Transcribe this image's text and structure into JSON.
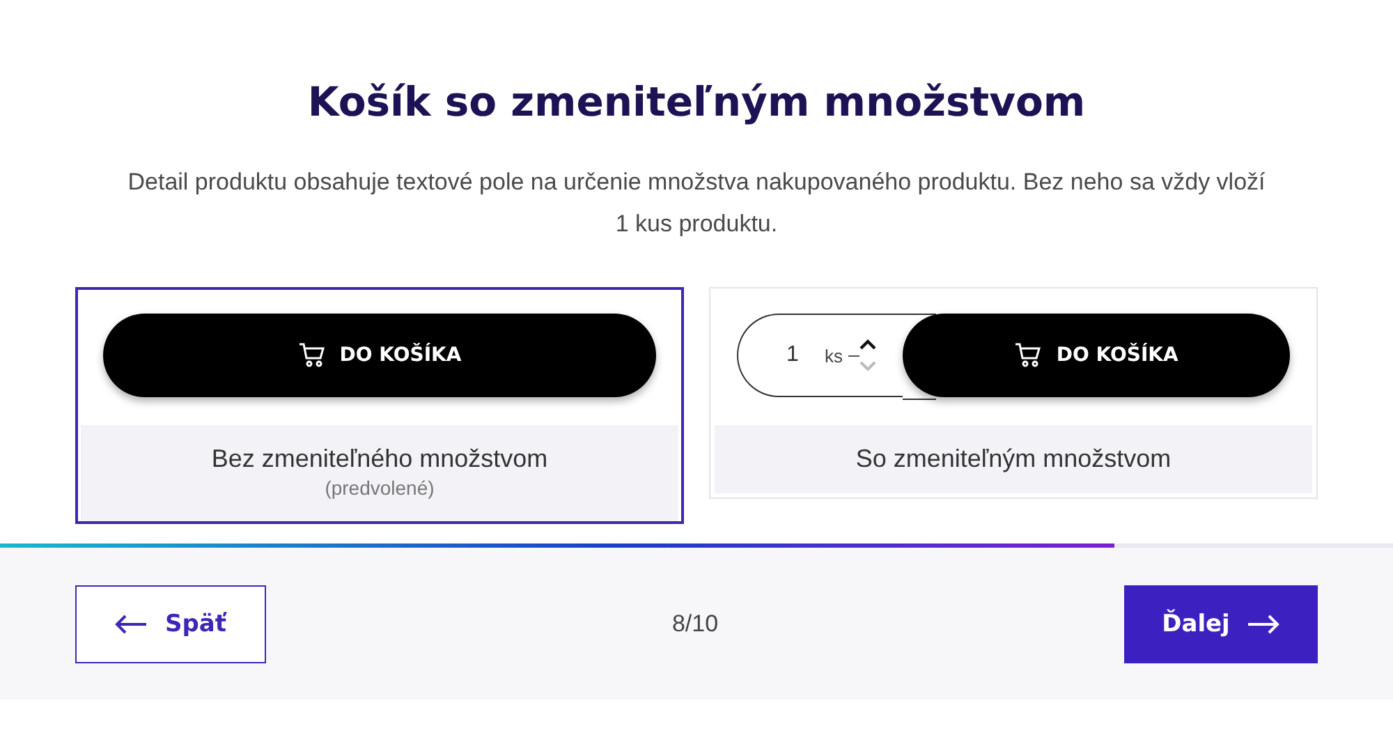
{
  "title": "Košík so zmeniteľným množstvom",
  "description": "Detail produktu obsahuje textové pole na určenie množstva nakupovaného produktu. Bez neho sa vždy vloží 1 kus produktu.",
  "options": [
    {
      "kind": "plain",
      "selected": true,
      "button": "DO KOŠÍKA",
      "label": "Bez zmeniteľného množstvom",
      "note": "(predvolené)"
    },
    {
      "kind": "quantity",
      "selected": false,
      "quantity": "1",
      "unit": "ks",
      "button": "DO KOŠÍKA",
      "label": "So zmeniteľným množstvom"
    }
  ],
  "progress": {
    "level": 0.8
  },
  "footer": {
    "back": "Späť",
    "step": "8/10",
    "next": "Ďalej"
  }
}
